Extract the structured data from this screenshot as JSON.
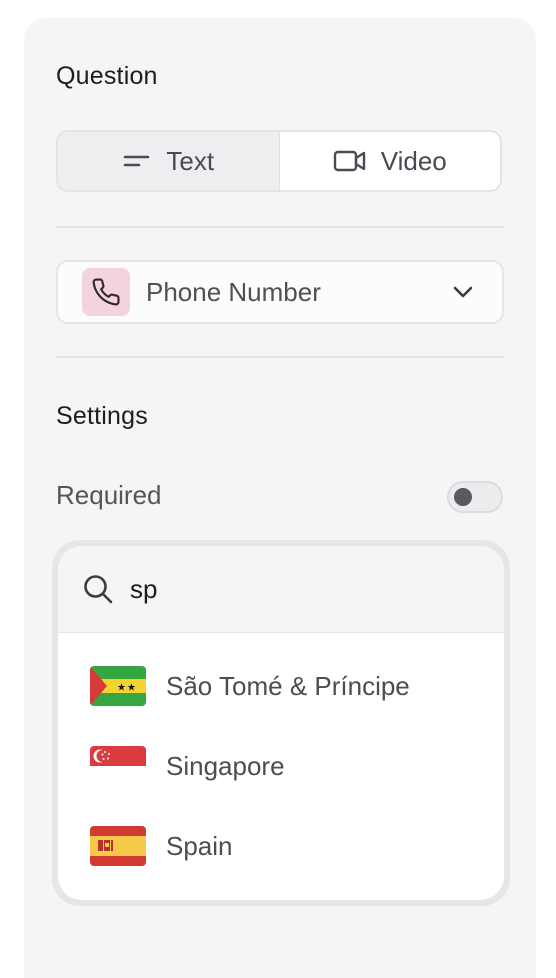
{
  "question": {
    "title": "Question",
    "tabs": [
      {
        "label": "Text",
        "icon": "text-lines-icon",
        "active": true
      },
      {
        "label": "Video",
        "icon": "video-camera-icon",
        "active": false
      }
    ]
  },
  "field_type": {
    "label": "Phone Number",
    "icon": "phone-icon",
    "badge_color": "#f3d3dc"
  },
  "settings": {
    "title": "Settings",
    "required_label": "Required",
    "required": false
  },
  "country_search": {
    "value": "sp",
    "options": [
      {
        "label": "São Tomé & Príncipe",
        "flag": "flag-sao-tome-and-principe"
      },
      {
        "label": "Singapore",
        "flag": "flag-singapore"
      },
      {
        "label": "Spain",
        "flag": "flag-spain"
      }
    ]
  }
}
